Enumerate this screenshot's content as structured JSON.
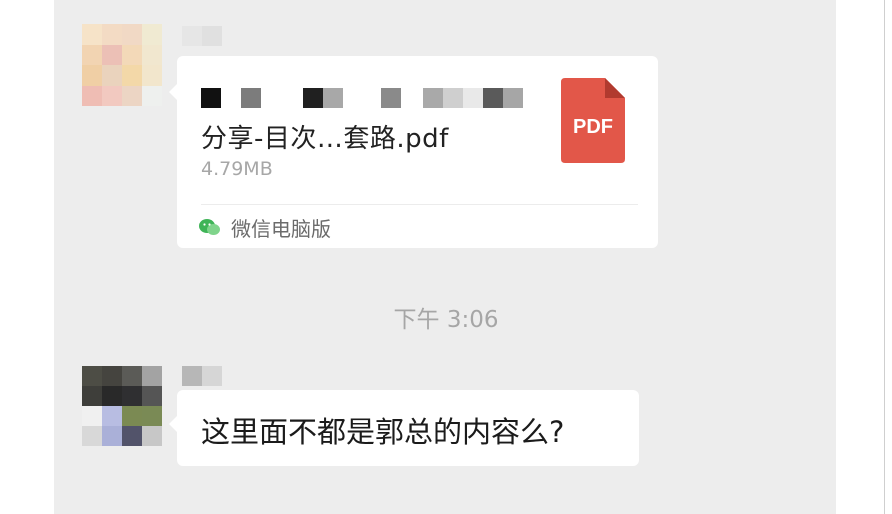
{
  "file_message": {
    "file_name_line2": "分享-目次…套路.pdf",
    "file_size": "4.79MB",
    "file_type_badge": "PDF",
    "source_app": "微信电脑版",
    "source_icon": "wechat-icon",
    "pdf_color": "#e25749"
  },
  "timestamp": "下午 3:06",
  "text_message": {
    "text": "这里面不都是郭总的内容么?"
  }
}
